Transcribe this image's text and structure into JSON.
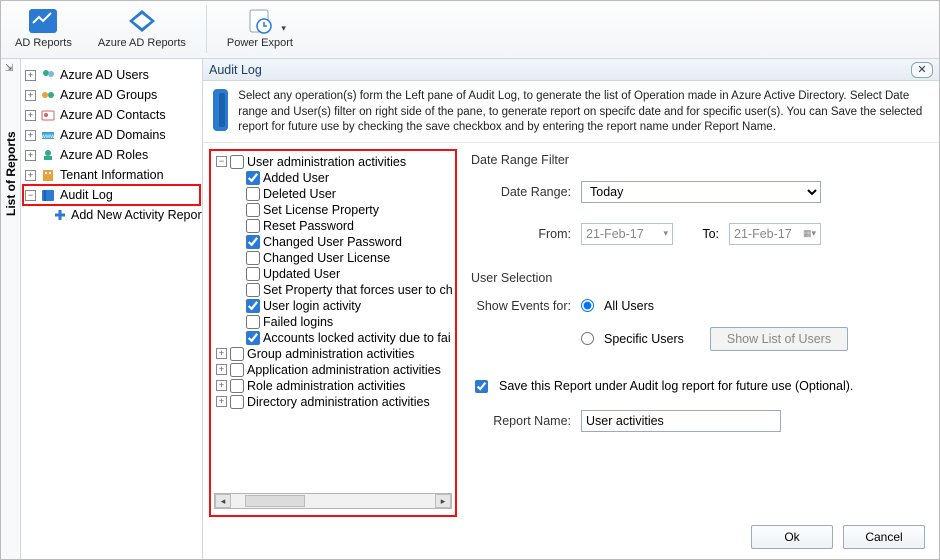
{
  "ribbon": {
    "ad_reports": "AD Reports",
    "azure_reports": "Azure AD Reports",
    "power_export": "Power Export"
  },
  "side_tab_label": "List of Reports",
  "nav": {
    "users": "Azure AD Users",
    "groups": "Azure AD Groups",
    "contacts": "Azure AD Contacts",
    "domains": "Azure AD Domains",
    "roles": "Azure AD Roles",
    "tenant": "Tenant Information",
    "audit": "Audit Log",
    "add_new": "Add New Activity Report"
  },
  "panel": {
    "title": "Audit Log",
    "desc": "Select any operation(s) form the Left pane of Audit Log, to generate the list of Operation made in Azure Active Directory. Select Date range and User(s) filter on right side of the pane, to generate report on specifc date and for specific user(s). You can Save the selected report for future use by checking the save checkbox and by entering the report name under Report Name."
  },
  "ops": {
    "user_admin": "User administration activities",
    "added_user": "Added User",
    "deleted_user": "Deleted User",
    "set_license": "Set License Property",
    "reset_pw": "Reset Password",
    "changed_pw": "Changed User Password",
    "changed_lic": "Changed User License",
    "updated_user": "Updated User",
    "set_prop_force": "Set Property that forces user to ch",
    "login_activity": "User login activity",
    "failed_logins": "Failed logins",
    "locked": "Accounts locked activity due to fai",
    "group_admin": "Group administration activities",
    "app_admin": "Application administration activities",
    "role_admin": "Role administration activities",
    "dir_admin": "Directory administration activities"
  },
  "form": {
    "date_filter_title": "Date Range Filter",
    "date_range_label": "Date Range:",
    "date_range_value": "Today",
    "from_label": "From:",
    "from_value": "21-Feb-17",
    "to_label": "To:",
    "to_value": "21-Feb-17",
    "user_sel_title": "User Selection",
    "show_events_label": "Show Events for:",
    "all_users": "All Users",
    "specific_users": "Specific Users",
    "show_list_btn": "Show List of Users",
    "save_label": "Save this Report under Audit log report for future use (Optional).",
    "report_name_label": "Report Name:",
    "report_name_value": "User activities",
    "ok": "Ok",
    "cancel": "Cancel"
  }
}
